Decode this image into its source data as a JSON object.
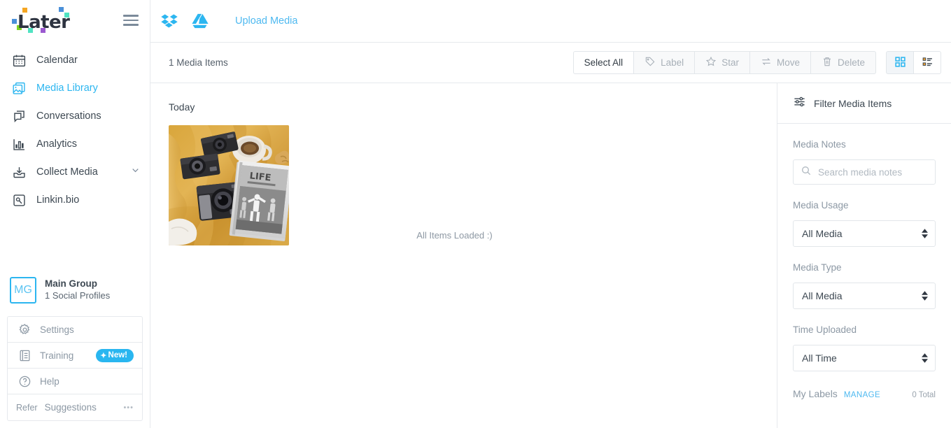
{
  "brand": {
    "logo_text": "Later",
    "accent": "#2cb6f0",
    "logo_squares": [
      "#f5a623",
      "#4a90d9",
      "#7ed321",
      "#50e3c2",
      "#9b59d0",
      "#f0c419"
    ]
  },
  "sidebar": {
    "menu_icon": "hamburger-icon",
    "items": [
      {
        "label": "Calendar",
        "icon": "calendar-icon",
        "active": false
      },
      {
        "label": "Media Library",
        "icon": "media-library-icon",
        "active": true
      },
      {
        "label": "Conversations",
        "icon": "conversations-icon",
        "active": false
      },
      {
        "label": "Analytics",
        "icon": "analytics-icon",
        "active": false
      },
      {
        "label": "Collect Media",
        "icon": "collect-media-icon",
        "active": false,
        "chevron": "chevron-down-icon"
      },
      {
        "label": "Linkin.bio",
        "icon": "linkin-bio-icon",
        "active": false
      }
    ],
    "group": {
      "initials": "MG",
      "name": "Main Group",
      "sub": "1 Social Profiles"
    },
    "utility": {
      "settings_label": "Settings",
      "training_label": "Training",
      "training_badge": "New!",
      "help_label": "Help",
      "refer_label": "Refer",
      "suggestions_label": "Suggestions",
      "more_dots": "•••"
    }
  },
  "upload_bar": {
    "dropbox_icon": "dropbox-icon",
    "google_drive_icon": "google-drive-icon",
    "upload_label": "Upload Media"
  },
  "action_bar": {
    "count_text": "1 Media Items",
    "buttons": [
      {
        "label": "Select All",
        "icon": null,
        "disabled": false
      },
      {
        "label": "Label",
        "icon": "tag-icon",
        "disabled": true
      },
      {
        "label": "Star",
        "icon": "star-icon",
        "disabled": true
      },
      {
        "label": "Move",
        "icon": "move-icon",
        "disabled": true
      },
      {
        "label": "Delete",
        "icon": "trash-icon",
        "disabled": true
      }
    ],
    "views": [
      {
        "name": "grid-view",
        "icon": "grid-icon",
        "active": true
      },
      {
        "name": "list-view",
        "icon": "list-icon",
        "active": false
      }
    ]
  },
  "gallery": {
    "day_label": "Today",
    "all_loaded_text": "All Items Loaded :)",
    "media_alt": "flat-lay of vintage cameras, coffee cup and magazine on yellow blanket"
  },
  "filter_panel": {
    "title": "Filter Media Items",
    "filter_icon": "sliders-icon",
    "media_notes_label": "Media Notes",
    "search_placeholder": "Search media notes",
    "search_value": "",
    "search_icon": "search-icon",
    "media_usage_label": "Media Usage",
    "media_usage_value": "All Media",
    "media_usage_options": [
      "All Media"
    ],
    "media_type_label": "Media Type",
    "media_type_value": "All Media",
    "media_type_options": [
      "All Media"
    ],
    "time_uploaded_label": "Time Uploaded",
    "time_uploaded_value": "All Time",
    "time_uploaded_options": [
      "All Time"
    ],
    "my_labels_label": "My Labels",
    "manage_label": "MANAGE",
    "labels_total": "0 Total"
  }
}
